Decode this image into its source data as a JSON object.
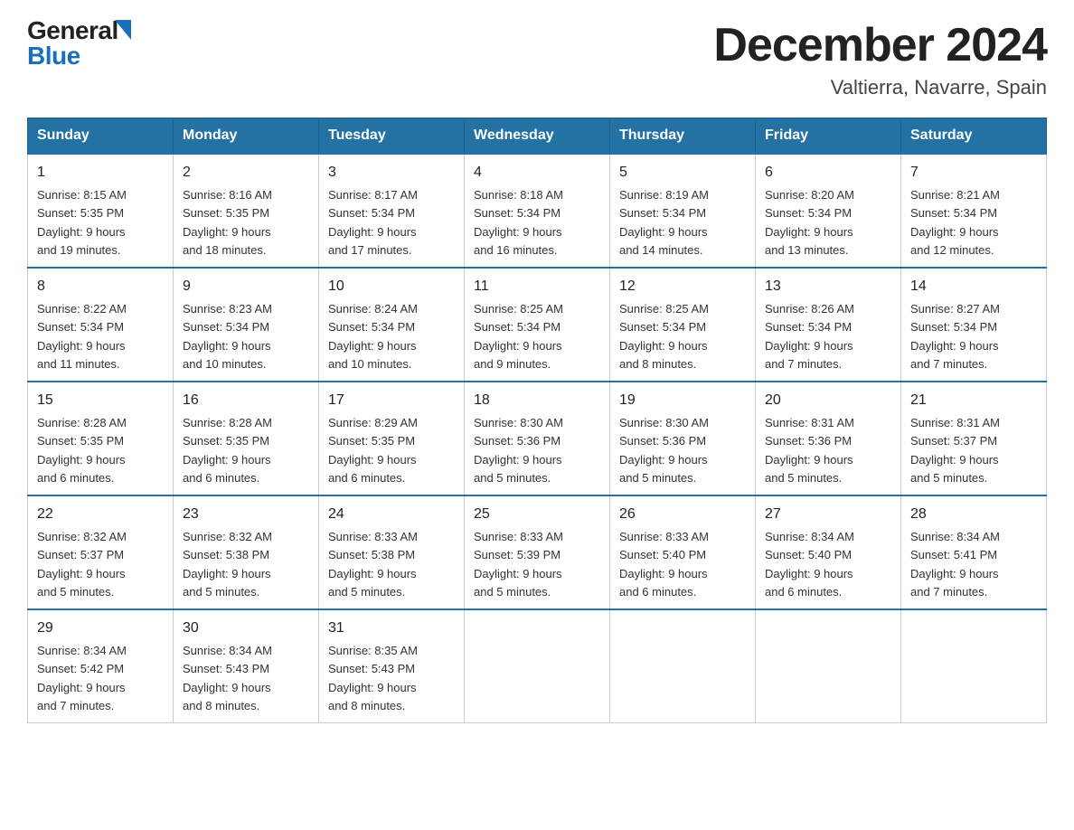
{
  "header": {
    "logo_general": "General",
    "logo_blue": "Blue",
    "month_title": "December 2024",
    "location": "Valtierra, Navarre, Spain"
  },
  "days_of_week": [
    "Sunday",
    "Monday",
    "Tuesday",
    "Wednesday",
    "Thursday",
    "Friday",
    "Saturday"
  ],
  "weeks": [
    [
      {
        "day": "1",
        "sunrise": "8:15 AM",
        "sunset": "5:35 PM",
        "daylight": "9 hours and 19 minutes."
      },
      {
        "day": "2",
        "sunrise": "8:16 AM",
        "sunset": "5:35 PM",
        "daylight": "9 hours and 18 minutes."
      },
      {
        "day": "3",
        "sunrise": "8:17 AM",
        "sunset": "5:34 PM",
        "daylight": "9 hours and 17 minutes."
      },
      {
        "day": "4",
        "sunrise": "8:18 AM",
        "sunset": "5:34 PM",
        "daylight": "9 hours and 16 minutes."
      },
      {
        "day": "5",
        "sunrise": "8:19 AM",
        "sunset": "5:34 PM",
        "daylight": "9 hours and 14 minutes."
      },
      {
        "day": "6",
        "sunrise": "8:20 AM",
        "sunset": "5:34 PM",
        "daylight": "9 hours and 13 minutes."
      },
      {
        "day": "7",
        "sunrise": "8:21 AM",
        "sunset": "5:34 PM",
        "daylight": "9 hours and 12 minutes."
      }
    ],
    [
      {
        "day": "8",
        "sunrise": "8:22 AM",
        "sunset": "5:34 PM",
        "daylight": "9 hours and 11 minutes."
      },
      {
        "day": "9",
        "sunrise": "8:23 AM",
        "sunset": "5:34 PM",
        "daylight": "9 hours and 10 minutes."
      },
      {
        "day": "10",
        "sunrise": "8:24 AM",
        "sunset": "5:34 PM",
        "daylight": "9 hours and 10 minutes."
      },
      {
        "day": "11",
        "sunrise": "8:25 AM",
        "sunset": "5:34 PM",
        "daylight": "9 hours and 9 minutes."
      },
      {
        "day": "12",
        "sunrise": "8:25 AM",
        "sunset": "5:34 PM",
        "daylight": "9 hours and 8 minutes."
      },
      {
        "day": "13",
        "sunrise": "8:26 AM",
        "sunset": "5:34 PM",
        "daylight": "9 hours and 7 minutes."
      },
      {
        "day": "14",
        "sunrise": "8:27 AM",
        "sunset": "5:34 PM",
        "daylight": "9 hours and 7 minutes."
      }
    ],
    [
      {
        "day": "15",
        "sunrise": "8:28 AM",
        "sunset": "5:35 PM",
        "daylight": "9 hours and 6 minutes."
      },
      {
        "day": "16",
        "sunrise": "8:28 AM",
        "sunset": "5:35 PM",
        "daylight": "9 hours and 6 minutes."
      },
      {
        "day": "17",
        "sunrise": "8:29 AM",
        "sunset": "5:35 PM",
        "daylight": "9 hours and 6 minutes."
      },
      {
        "day": "18",
        "sunrise": "8:30 AM",
        "sunset": "5:36 PM",
        "daylight": "9 hours and 5 minutes."
      },
      {
        "day": "19",
        "sunrise": "8:30 AM",
        "sunset": "5:36 PM",
        "daylight": "9 hours and 5 minutes."
      },
      {
        "day": "20",
        "sunrise": "8:31 AM",
        "sunset": "5:36 PM",
        "daylight": "9 hours and 5 minutes."
      },
      {
        "day": "21",
        "sunrise": "8:31 AM",
        "sunset": "5:37 PM",
        "daylight": "9 hours and 5 minutes."
      }
    ],
    [
      {
        "day": "22",
        "sunrise": "8:32 AM",
        "sunset": "5:37 PM",
        "daylight": "9 hours and 5 minutes."
      },
      {
        "day": "23",
        "sunrise": "8:32 AM",
        "sunset": "5:38 PM",
        "daylight": "9 hours and 5 minutes."
      },
      {
        "day": "24",
        "sunrise": "8:33 AM",
        "sunset": "5:38 PM",
        "daylight": "9 hours and 5 minutes."
      },
      {
        "day": "25",
        "sunrise": "8:33 AM",
        "sunset": "5:39 PM",
        "daylight": "9 hours and 5 minutes."
      },
      {
        "day": "26",
        "sunrise": "8:33 AM",
        "sunset": "5:40 PM",
        "daylight": "9 hours and 6 minutes."
      },
      {
        "day": "27",
        "sunrise": "8:34 AM",
        "sunset": "5:40 PM",
        "daylight": "9 hours and 6 minutes."
      },
      {
        "day": "28",
        "sunrise": "8:34 AM",
        "sunset": "5:41 PM",
        "daylight": "9 hours and 7 minutes."
      }
    ],
    [
      {
        "day": "29",
        "sunrise": "8:34 AM",
        "sunset": "5:42 PM",
        "daylight": "9 hours and 7 minutes."
      },
      {
        "day": "30",
        "sunrise": "8:34 AM",
        "sunset": "5:43 PM",
        "daylight": "9 hours and 8 minutes."
      },
      {
        "day": "31",
        "sunrise": "8:35 AM",
        "sunset": "5:43 PM",
        "daylight": "9 hours and 8 minutes."
      },
      null,
      null,
      null,
      null
    ]
  ],
  "labels": {
    "sunrise": "Sunrise:",
    "sunset": "Sunset:",
    "daylight": "Daylight:"
  }
}
